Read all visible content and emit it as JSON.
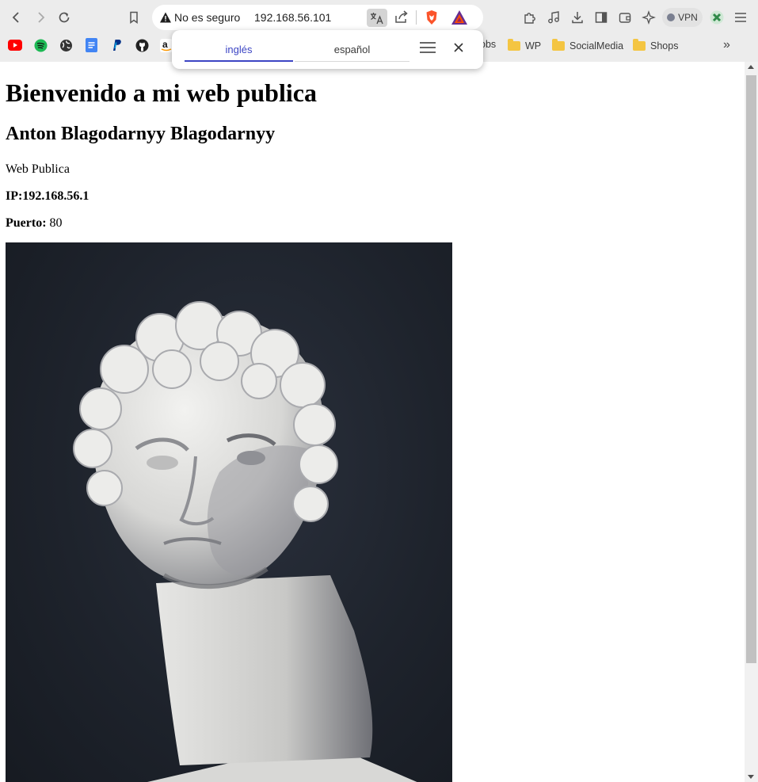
{
  "browser": {
    "url_security_label": "No es seguro",
    "url_host": "192.168.56.101",
    "vpn_label": "VPN",
    "bookmarks": {
      "partial_label": "obs",
      "folders": [
        "WP",
        "SocialMedia",
        "Shops"
      ],
      "more_glyph": "»"
    },
    "translate_popup": {
      "source_language": "inglés",
      "target_language": "español"
    }
  },
  "page": {
    "heading": "Bienvenido a mi web publica",
    "subheading": "Anton Blagodarnyy Blagodarnyy",
    "description": "Web Publica",
    "ip_line": "IP:192.168.56.1",
    "port_label": "Puerto:",
    "port_value": " 80"
  },
  "colors": {
    "chrome_bg": "#ececec",
    "translate_accent": "#3c45c4",
    "photo_bg": "#1e232c"
  }
}
